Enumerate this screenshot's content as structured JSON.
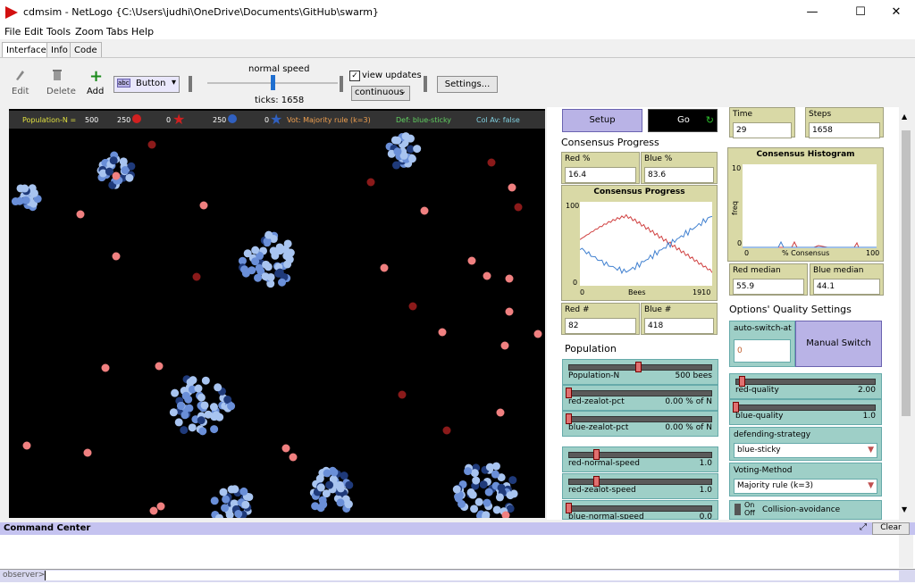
{
  "window": {
    "title": "cdmsim - NetLogo {C:\\Users\\judhi\\OneDrive\\Documents\\GitHub\\swarm}",
    "minimize": "—",
    "maximize": "☐",
    "close": "✕"
  },
  "menu": [
    "File",
    "Edit",
    "Tools",
    "Zoom",
    "Tabs",
    "Help"
  ],
  "tabs": [
    "Interface",
    "Info",
    "Code"
  ],
  "toolbar": {
    "edit": "Edit",
    "delete": "Delete",
    "add": "Add",
    "widget_type": "Button",
    "speed_label": "normal speed",
    "ticks": "ticks: 1658",
    "view_updates": "view updates",
    "update_mode": "continuous",
    "settings": "Settings..."
  },
  "infobar": {
    "population": "Population-N =",
    "population_val": "500",
    "red_count": "250",
    "red_zealot": "0",
    "blue_count": "250",
    "blue_zealot": "0",
    "voting": "Vot: Majority rule (k=3)",
    "defending": "Def: blue-sticky",
    "collision": "Col Av: false"
  },
  "controls": {
    "setup": "Setup",
    "go": "Go",
    "time_label": "Time",
    "time_value": "29",
    "steps_label": "Steps",
    "steps_value": "1658",
    "consensus_progress_note": "Consensus Progress",
    "red_pct_label": "Red %",
    "red_pct_value": "16.4",
    "blue_pct_label": "Blue %",
    "blue_pct_value": "83.6",
    "red_num_label": "Red #",
    "red_num_value": "82",
    "blue_num_label": "Blue #",
    "blue_num_value": "418",
    "red_median_label": "Red median",
    "red_median_value": "55.9",
    "blue_median_label": "Blue median",
    "blue_median_value": "44.1",
    "population_note": "Population",
    "options_note": "Options' Quality Settings",
    "auto_switch_label": "auto-switch-at",
    "auto_switch_value": "0",
    "manual_switch": "Manual Switch",
    "defending_label": "defending-strategy",
    "defending_value": "blue-sticky",
    "voting_label": "Voting-Method",
    "voting_value": "Majority rule (k=3)",
    "collision_on": "On",
    "collision_off": "Off",
    "collision_label": "Collision-avoidance"
  },
  "sliders": [
    {
      "name": "Population-N",
      "value": "500 bees",
      "level": 0.5
    },
    {
      "name": "red-zealot-pct",
      "value": "0.00 % of N",
      "level": 0.0
    },
    {
      "name": "blue-zealot-pct",
      "value": "0.00 % of N",
      "level": 0.0
    },
    {
      "name": "red-normal-speed",
      "value": "1.0",
      "level": 0.2
    },
    {
      "name": "red-zealot-speed",
      "value": "1.0",
      "level": 0.2
    },
    {
      "name": "blue-normal-speed",
      "value": "0.0",
      "level": 0.0
    },
    {
      "name": "red-quality",
      "value": "2.00",
      "level": 0.05
    },
    {
      "name": "blue-quality",
      "value": "1.0",
      "level": 0.0
    }
  ],
  "plot_progress": {
    "title": "Consensus Progress",
    "ymax": "100",
    "ymin": "0",
    "xmin": "0",
    "xmax": "1910",
    "xlabel": "Bees"
  },
  "plot_histogram": {
    "title": "Consensus Histogram",
    "ymax": "10",
    "ymin": "0",
    "xmin": "0",
    "xmax": "100",
    "xlabel": "% Consensus",
    "ylabel": "freq"
  },
  "command_center": {
    "title": "Command Center",
    "clear": "Clear",
    "prompt": "observer>"
  },
  "colors": {
    "red_agent": "#f08080",
    "dark_red": "#8b1a1a",
    "blue_agent": "#6a8fd8",
    "light_blue": "#a8c4f0",
    "dark_blue": "#1f3a7a"
  }
}
